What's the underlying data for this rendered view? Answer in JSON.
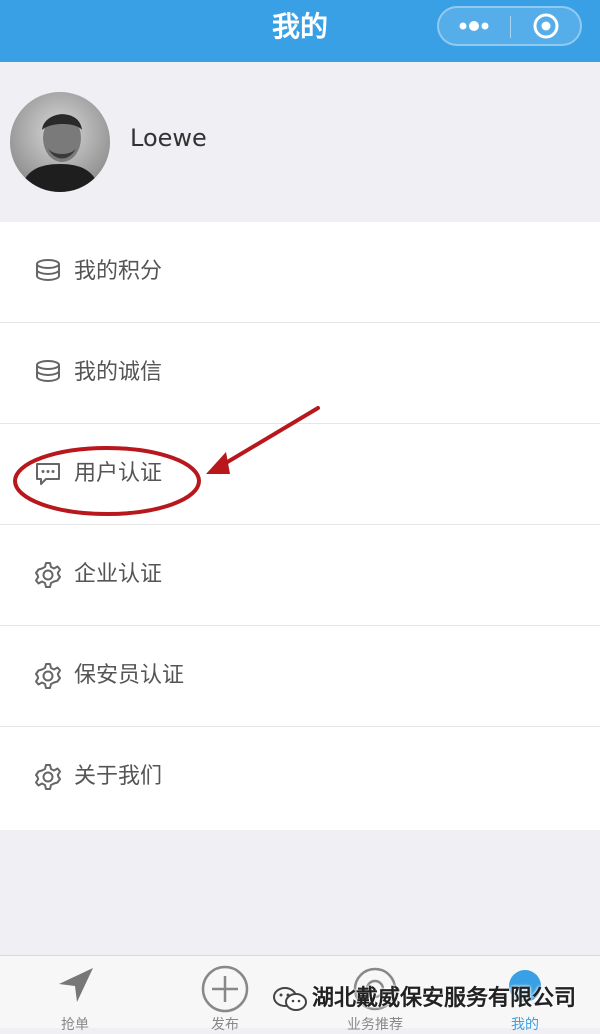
{
  "header": {
    "title": "我的"
  },
  "capsule": {
    "more_icon": "more-dots-icon",
    "close_icon": "target-circle-icon"
  },
  "profile": {
    "username": "Loewe"
  },
  "menu": {
    "items": [
      {
        "label": "我的积分",
        "icon": "coin-stack-icon"
      },
      {
        "label": "我的诚信",
        "icon": "coin-stack-icon"
      },
      {
        "label": "用户认证",
        "icon": "chat-bubble-icon"
      },
      {
        "label": "企业认证",
        "icon": "gear-icon"
      },
      {
        "label": "保安员认证",
        "icon": "gear-icon"
      },
      {
        "label": "关于我们",
        "icon": "gear-icon"
      }
    ]
  },
  "tabbar": {
    "tabs": [
      {
        "label": "抢单",
        "icon": "navigation-arrow-icon",
        "active": false
      },
      {
        "label": "发布",
        "icon": "plus-circle-icon",
        "active": false
      },
      {
        "label": "业务推荐",
        "icon": "circle-icon",
        "active": false
      },
      {
        "label": "我的",
        "icon": "person-icon",
        "active": true
      }
    ]
  },
  "watermark": {
    "text": "湖北戴威保安服务有限公司"
  },
  "colors": {
    "header": "#3aa0e6",
    "annotation": "#b8171c",
    "active_tab": "#3aa0e6"
  }
}
